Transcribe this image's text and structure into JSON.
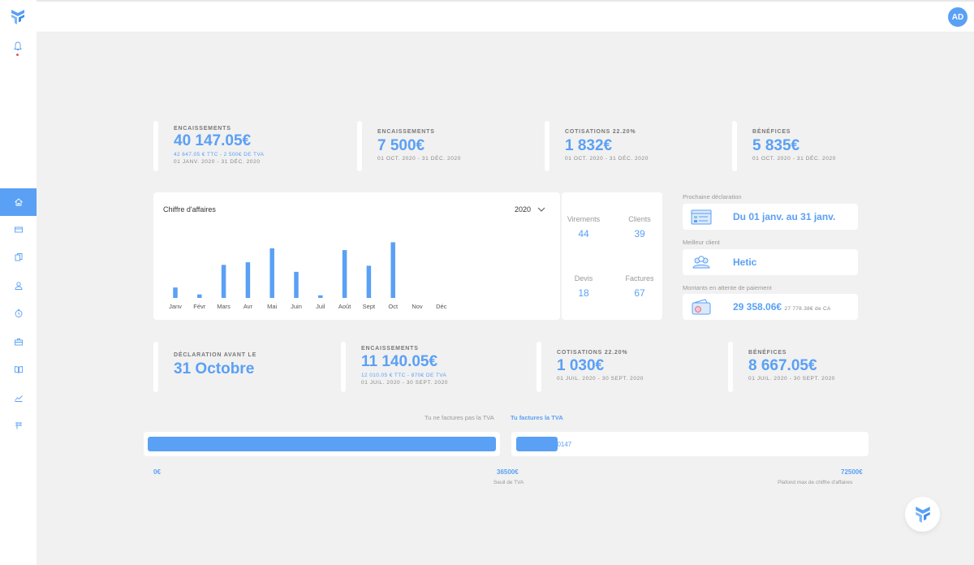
{
  "user": {
    "initials": "AD"
  },
  "colors": {
    "accent": "#5aa0f5",
    "alert": "#e05a6a"
  },
  "sidebar": {
    "items": [
      {
        "icon": "home-icon",
        "active": true
      },
      {
        "icon": "card-icon"
      },
      {
        "icon": "documents-icon"
      },
      {
        "icon": "user-icon"
      },
      {
        "icon": "timer-icon"
      },
      {
        "icon": "briefcase-icon"
      },
      {
        "icon": "book-icon"
      },
      {
        "icon": "chart-line-icon"
      },
      {
        "icon": "flag-icon"
      }
    ]
  },
  "top_stats": [
    {
      "label": "ENCAISSEMENTS",
      "value": "40 147.05€",
      "sub": "42 647.05 € TTC - 2 500€ DE TVA",
      "date": "01 JANV. 2020 - 31 DÉC. 2020"
    },
    {
      "label": "ENCAISSEMENTS",
      "value": "7 500€",
      "date": "01 OCT. 2020 - 31 DÉC. 2020"
    },
    {
      "label": "COTISATIONS 22.20%",
      "value": "1 832€",
      "date": "01 OCT. 2020 - 31 DÉC. 2020"
    },
    {
      "label": "BÉNÉFICES",
      "value": "5 835€",
      "date": "01 OCT. 2020 - 31 DÉC. 2020"
    }
  ],
  "chart": {
    "title": "Chiffre d'affaires",
    "year": "2020"
  },
  "chart_data": {
    "type": "bar",
    "title": "Chiffre d'affaires",
    "categories": [
      "Janv",
      "Févr",
      "Mars",
      "Avr",
      "Mai",
      "Juin",
      "Juil",
      "Août",
      "Sept",
      "Oct",
      "Nov",
      "Déc"
    ],
    "values": [
      12,
      4,
      38,
      41,
      57,
      30,
      3,
      55,
      37,
      64,
      0,
      0
    ],
    "ylim": [
      0,
      70
    ],
    "grid": false
  },
  "mini_stats": {
    "virements_label": "Virements",
    "virements_value": "44",
    "clients_label": "Clients",
    "clients_value": "39",
    "devis_label": "Devis",
    "devis_value": "18",
    "factures_label": "Factures",
    "factures_value": "67"
  },
  "right_panel": {
    "next_decl_label": "Prochaine déclaration",
    "next_decl_value": "Du 01 janv. au 31 janv.",
    "best_client_label": "Meilleur client",
    "best_client_value": "Hetic",
    "pending_label": "Montants en attente de paiement",
    "pending_value": "29 358.06€",
    "pending_sub": "27 778.38€ de CA"
  },
  "bottom_stats": [
    {
      "label": "DÉCLARATION AVANT LE",
      "value": "31 Octobre"
    },
    {
      "label": "ENCAISSEMENTS",
      "value": "11 140.05€",
      "sub": "12 010.05 € TTC - 870€ DE TVA",
      "date": "01 JUIL. 2020 - 30 SEPT. 2020"
    },
    {
      "label": "COTISATIONS 22.20%",
      "value": "1 030€",
      "date": "01 JUIL. 2020 - 30 SEPT. 2020"
    },
    {
      "label": "BÉNÉFICES",
      "value": "8 667.05€",
      "date": "01 JUIL. 2020 - 30 SEPT. 2020"
    }
  ],
  "tva": {
    "no_tva_label": "Tu ne factures pas la TVA",
    "tva_label": "Tu factures la TVA",
    "current_value": "40147",
    "first_bar_fill": 1.0,
    "second_bar_fill": 0.119,
    "scale_min": "0€",
    "scale_mid": "36500€",
    "scale_mid_label": "Seuil de TVA",
    "scale_max": "72500€",
    "scale_max_label": "Plafond max de chiffre d'affaires"
  }
}
